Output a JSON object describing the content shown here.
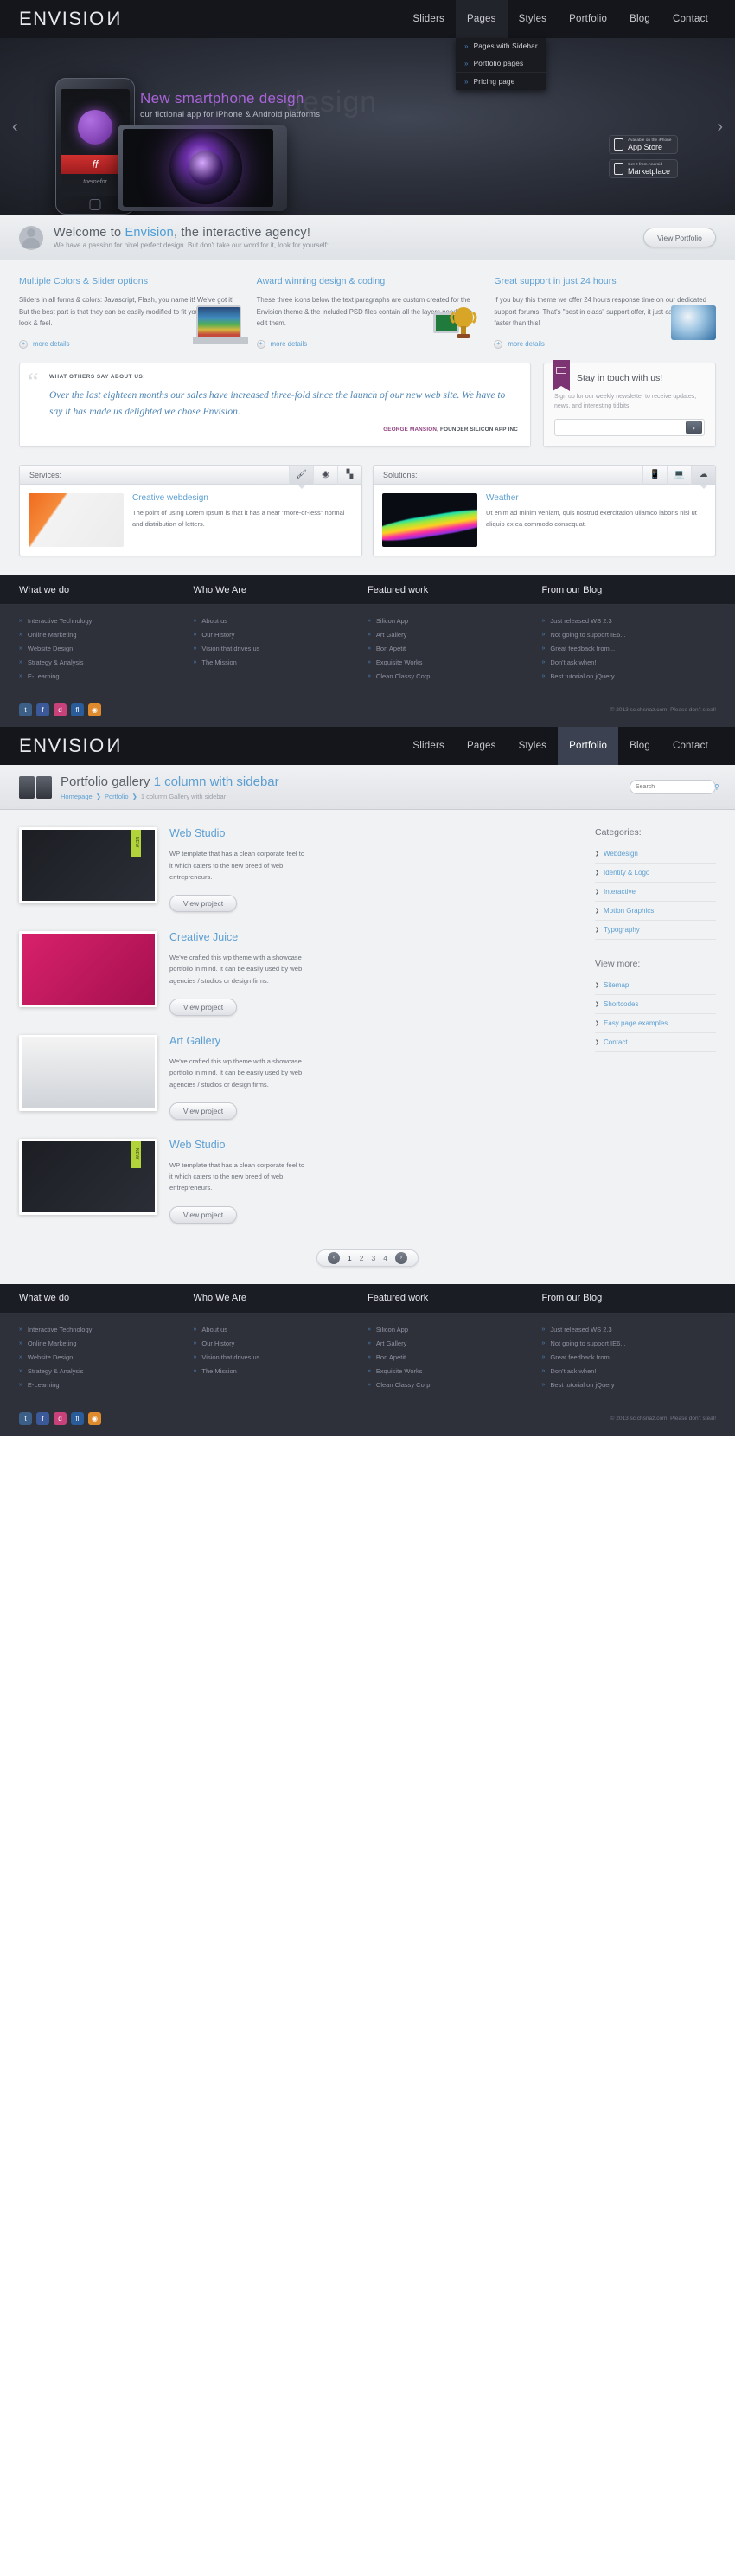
{
  "brand": {
    "name": "ENVISIO",
    "last_letter": "N"
  },
  "nav": {
    "items": [
      {
        "label": "Sliders"
      },
      {
        "label": "Pages"
      },
      {
        "label": "Styles"
      },
      {
        "label": "Portfolio"
      },
      {
        "label": "Blog"
      },
      {
        "label": "Contact"
      }
    ],
    "dropdown": [
      {
        "label": "Pages with Sidebar"
      },
      {
        "label": "Portfolio pages"
      },
      {
        "label": "Pricing page"
      }
    ]
  },
  "hero": {
    "watermark": "design",
    "title": "New smartphone design",
    "subtitle": "our fictional app for iPhone & Android platforms",
    "phone_band": "ff",
    "phone_foot": "themefor",
    "buttons": [
      {
        "small": "Available on the iPhone",
        "big": "App Store",
        "icon": "phone-icon"
      },
      {
        "small": "Get it from Android",
        "big": "Marketplace",
        "icon": "android-icon"
      }
    ],
    "arrow_prev": "‹",
    "arrow_next": "›"
  },
  "welcome": {
    "title_pre": "Welcome to ",
    "title_hl": "Envision",
    "title_post": ", the interactive agency!",
    "subtitle": "We have a passion for pixel perfect design. But don't take our word for it, look for yourself:",
    "button": "View Portfolio"
  },
  "features": [
    {
      "title": "Multiple Colors & Slider options",
      "body": "Sliders in all forms & colors: Javascript, Flash, you name it! We've got it! But the best part is that they can be easily modified to fit your company's look & feel.",
      "more": "more details",
      "icon": "laptop-icon"
    },
    {
      "title": "Award winning design & coding",
      "body": "These three icons below the text paragraphs are custom created for the Envision theme & the included PSD files contain all the layers needed to edit them.",
      "more": "more details",
      "icon": "trophy-icon"
    },
    {
      "title": "Great support in just 24 hours",
      "body": "If you buy this theme we offer 24 hours response time on our dedicated support forums. That's \"best in class\" support offer, it just can't get better & faster than this!",
      "more": "more details",
      "icon": "globe-icon"
    }
  ],
  "testimonial": {
    "label": "WHAT OTHERS SAY ABOUT US:",
    "quote": "Over the last eighteen months our sales have increased three-fold since the launch of our new web site. We have to say it has made us delighted we chose Envision.",
    "author": "GEORGE MANSION,",
    "role": " FOUNDER SILICON APP INC"
  },
  "newsletter": {
    "title": "Stay in touch with us!",
    "body": "Sign up for our weekly newsletter to receive updates, news, and interesting tidbits.",
    "placeholder": "",
    "submit": "›"
  },
  "panels": [
    {
      "title": "Services:",
      "tabs": [
        "brush-icon",
        "camera-icon",
        "chart-icon"
      ],
      "selected": 0,
      "item_title": "Creative webdesign",
      "item_body": "The point of using Lorem Ipsum is that it has a near \"more-or-less\" normal and distribution of letters.",
      "thumb": "orange-interior-photo"
    },
    {
      "title": "Solutions:",
      "tabs": [
        "mobile-icon",
        "desktop-icon",
        "cloud-icon"
      ],
      "selected": 2,
      "item_title": "Weather",
      "item_body": "Ut enim ad minim veniam, quis nostrud exercitation ullamco laboris nisi ut aliquip ex ea commodo consequat.",
      "thumb": "neon-waves-photo"
    }
  ],
  "footer": {
    "headings": [
      "What we do",
      "Who We Are",
      "Featured work",
      "From our Blog"
    ],
    "col1": [
      "Interactive Technology",
      "Online Marketing",
      "Website Design",
      "Strategy & Analysis",
      "E-Learning"
    ],
    "col2": [
      "About us",
      "Our History",
      "Vision that drives us",
      "The Mission"
    ],
    "col3": [
      "Silicon App",
      "Art Gallery",
      "Bon Apetit",
      "Exquisite Works",
      "Clean Classy Corp"
    ],
    "col4": [
      "Just released WS 2.3",
      "Not going to support IE6...",
      "Great feedback from...",
      "Don't ask when!",
      "Best tutorial on jQuery"
    ],
    "social": [
      "t",
      "f",
      "d",
      "fl",
      "◉"
    ],
    "copyright": "© 2013 sc.chsnaz.com. Please don't steal!"
  },
  "page2": {
    "title_pre": "Portfolio gallery ",
    "title_hl": "1 column with sidebar",
    "breadcrumb": {
      "home": "Homepage",
      "section": "Portfolio",
      "current": "1 column Gallery with sidebar",
      "sep": "❯"
    },
    "search_placeholder": "Search",
    "portfolio": [
      {
        "name": "Web Studio",
        "body": "WP template that has a clean corporate feel to it which caters to the new breed of web entrepreneurs.",
        "button": "View project",
        "badge": "NEW",
        "thumb": "dark-studio-screenshot"
      },
      {
        "name": "Creative Juice",
        "body": "We've crafted this wp theme with a showcase portfolio in mind. It can be easily used by web agencies / studios or design firms.",
        "button": "View project",
        "badge": "",
        "thumb": "pink-latest-project-screenshot"
      },
      {
        "name": "Art Gallery",
        "body": "We've crafted this wp theme with a showcase portfolio in mind. It can be easily used by web agencies / studios or design firms.",
        "button": "View project",
        "badge": "",
        "thumb": "photo-art-gallery-screenshot"
      },
      {
        "name": "Web Studio",
        "body": "WP template that has a clean corporate feel to it which caters to the new breed of web entrepreneurs.",
        "button": "View project",
        "badge": "NEW",
        "thumb": "dark-studio-screenshot"
      }
    ],
    "sidebar": {
      "categories_heading": "Categories:",
      "categories": [
        "Webdesign",
        "Identity & Logo",
        "Interactive",
        "Motion Graphics",
        "Typography"
      ],
      "viewmore_heading": "View more:",
      "viewmore": [
        "Sitemap",
        "Shortcodes",
        "Easy page examples",
        "Contact"
      ]
    },
    "pagination": {
      "prev": "‹",
      "next": "›",
      "pages": [
        "1",
        "2",
        "3",
        "4"
      ],
      "current": "1"
    }
  }
}
